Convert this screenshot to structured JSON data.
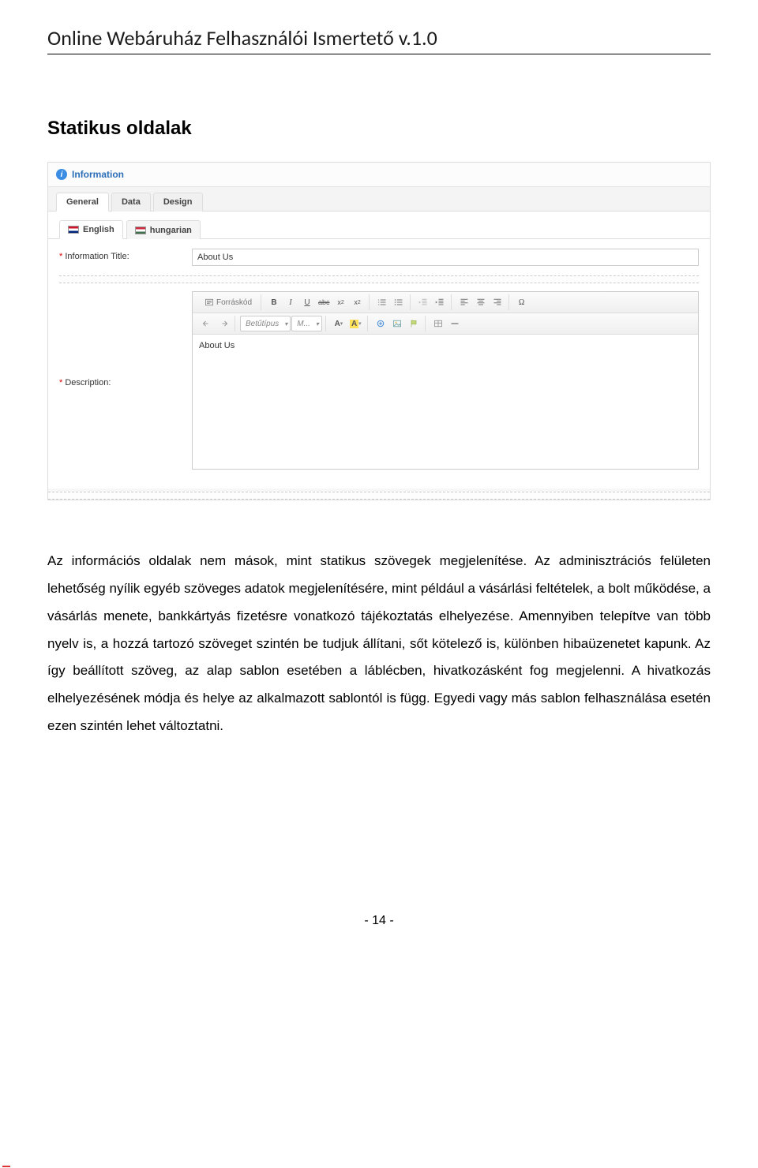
{
  "document": {
    "header": "Online Webáruház Felhasználói Ismertető  v.1.0",
    "section_title": "Statikus oldalak",
    "footer": "- 14 -"
  },
  "panel": {
    "title": "Information",
    "tabs": {
      "general": "General",
      "data": "Data",
      "design": "Design"
    },
    "langs": {
      "english": "English",
      "hungarian": "hungarian"
    },
    "fields": {
      "title_label": "Information Title:",
      "title_value": "About Us",
      "description_label": "Description:"
    },
    "editor": {
      "source_label": "Forráskód",
      "font_dropdown": "Betűtípus",
      "size_dropdown": "M...",
      "content": "About Us"
    }
  },
  "body_text": "Az információs oldalak nem mások, mint statikus szövegek megjelenítése. Az adminisztrációs felületen lehetőség nyílik egyéb szöveges adatok megjelenítésére, mint például a vásárlási feltételek, a bolt működése, a vásárlás menete, bankkártyás fizetésre vonatkozó tájékoztatás elhelyezése. Amennyiben telepítve van több nyelv is, a hozzá tartozó szöveget szintén be tudjuk állítani, sőt kötelező is, különben hibaüzenetet kapunk. Az így beállított szöveg, az alap sablon esetében a láblécben, hivatkozásként fog megjelenni. A hivatkozás elhelyezésének módja és helye az alkalmazott sablontól is függ. Egyedi vagy más sablon felhasználása esetén ezen szintén lehet változtatni."
}
